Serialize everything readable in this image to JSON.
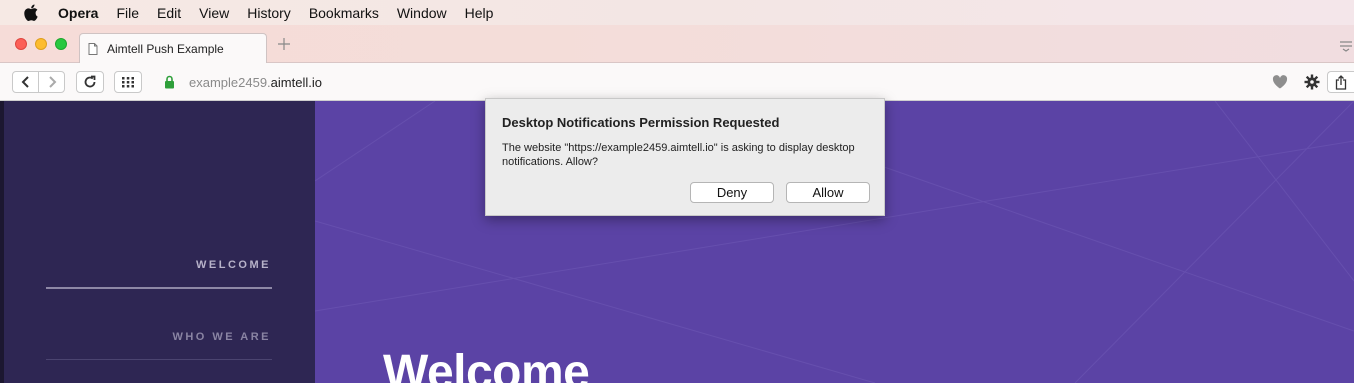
{
  "menubar": {
    "app": "Opera",
    "items": [
      "File",
      "Edit",
      "View",
      "History",
      "Bookmarks",
      "Window",
      "Help"
    ]
  },
  "tab": {
    "title": "Aimtell Push Example",
    "icon": "page-icon"
  },
  "address": {
    "host_prefix": "example2459.",
    "host_domain": "aimtell.io"
  },
  "sidebar": {
    "items": [
      {
        "label": "WELCOME",
        "active": true
      },
      {
        "label": "WHO WE ARE",
        "active": false
      }
    ]
  },
  "hero": {
    "title": "Welcome"
  },
  "dialog": {
    "title": "Desktop Notifications Permission Requested",
    "message": "The website \"https://example2459.aimtell.io\" is asking to display desktop notifications. Allow?",
    "deny_label": "Deny",
    "allow_label": "Allow"
  },
  "colors": {
    "sidebar_bg": "#2e2653",
    "hero_bg": "#5b43a5",
    "dialog_bg": "#ececec"
  }
}
